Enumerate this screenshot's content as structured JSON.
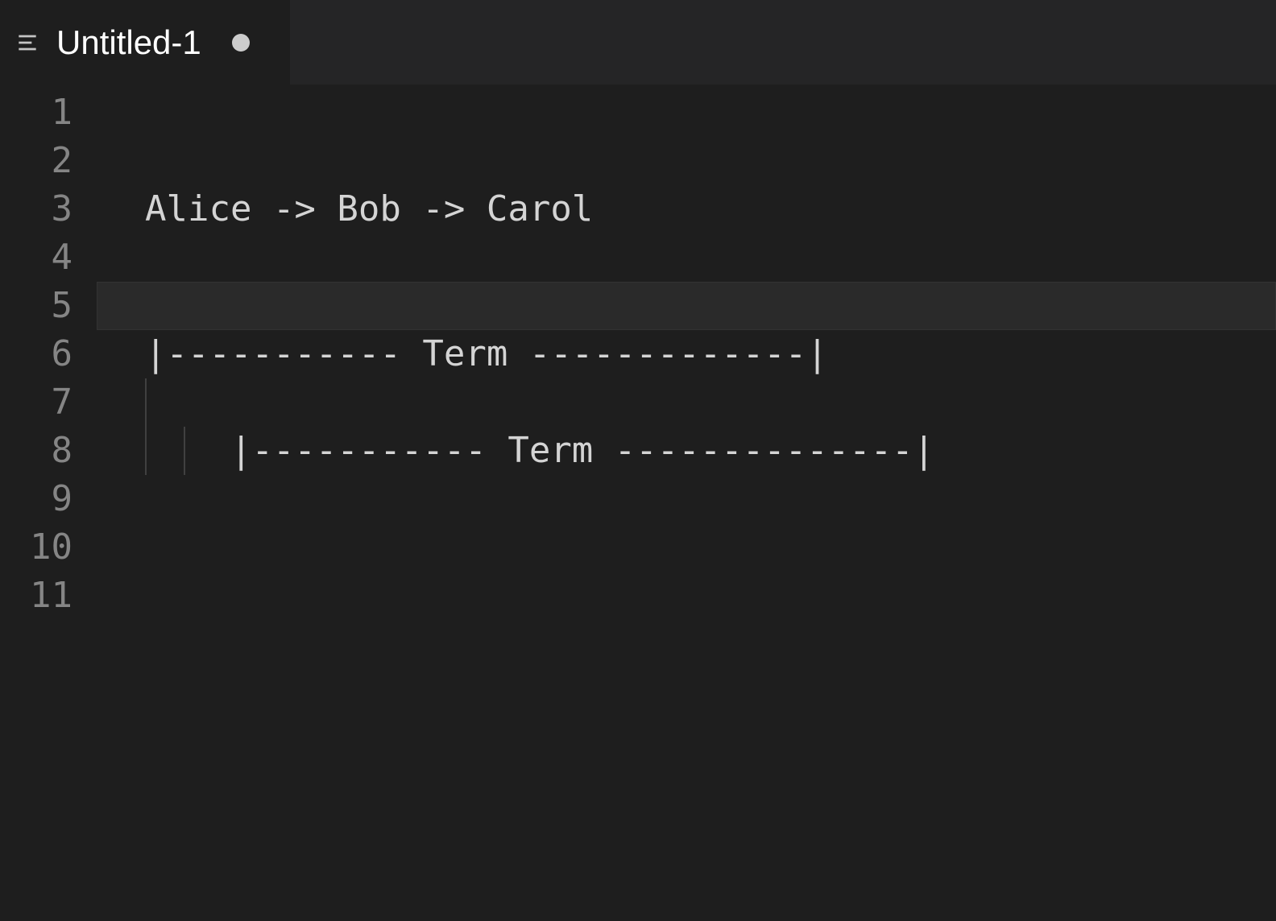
{
  "tab": {
    "title": "Untitled-1",
    "dirty": true
  },
  "editor": {
    "active_line": 5,
    "lines": [
      {
        "num": "1",
        "text": ""
      },
      {
        "num": "2",
        "text": ""
      },
      {
        "num": "3",
        "text": "Alice -> Bob -> Carol"
      },
      {
        "num": "4",
        "text": ""
      },
      {
        "num": "5",
        "text": ""
      },
      {
        "num": "6",
        "text": "|----------- Term -------------|"
      },
      {
        "num": "7",
        "text": ""
      },
      {
        "num": "8",
        "text": "    |----------- Term --------------|"
      },
      {
        "num": "9",
        "text": ""
      },
      {
        "num": "10",
        "text": ""
      },
      {
        "num": "11",
        "text": ""
      }
    ]
  }
}
